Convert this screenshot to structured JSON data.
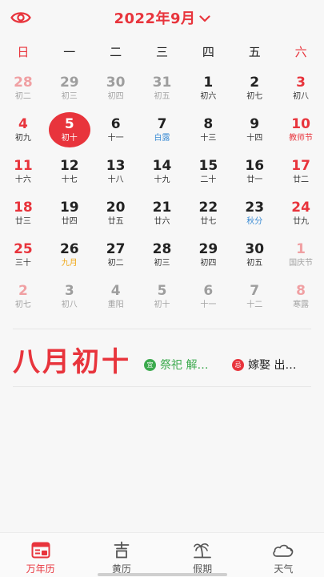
{
  "header": {
    "title": "2022年9月",
    "icons": {
      "left": "eye-icon",
      "title_suffix": "chevron-down-icon"
    }
  },
  "weekdays": [
    "日",
    "一",
    "二",
    "三",
    "四",
    "五",
    "六"
  ],
  "calendar": {
    "rows": [
      [
        {
          "day": "28",
          "sub": "初二",
          "other": true,
          "weekend": true
        },
        {
          "day": "29",
          "sub": "初三",
          "other": true
        },
        {
          "day": "30",
          "sub": "初四",
          "other": true
        },
        {
          "day": "31",
          "sub": "初五",
          "other": true
        },
        {
          "day": "1",
          "sub": "初六"
        },
        {
          "day": "2",
          "sub": "初七"
        },
        {
          "day": "3",
          "sub": "初八",
          "weekend": true
        }
      ],
      [
        {
          "day": "4",
          "sub": "初九",
          "weekend": true
        },
        {
          "day": "5",
          "sub": "初十",
          "today": true
        },
        {
          "day": "6",
          "sub": "十一"
        },
        {
          "day": "7",
          "sub": "白露",
          "sub_style": "term"
        },
        {
          "day": "8",
          "sub": "十三"
        },
        {
          "day": "9",
          "sub": "十四"
        },
        {
          "day": "10",
          "sub": "教师节",
          "weekend": true,
          "sub_style": "festival"
        }
      ],
      [
        {
          "day": "11",
          "sub": "十六",
          "weekend": true
        },
        {
          "day": "12",
          "sub": "十七"
        },
        {
          "day": "13",
          "sub": "十八"
        },
        {
          "day": "14",
          "sub": "十九"
        },
        {
          "day": "15",
          "sub": "二十"
        },
        {
          "day": "16",
          "sub": "廿一"
        },
        {
          "day": "17",
          "sub": "廿二",
          "weekend": true
        }
      ],
      [
        {
          "day": "18",
          "sub": "廿三",
          "weekend": true
        },
        {
          "day": "19",
          "sub": "廿四"
        },
        {
          "day": "20",
          "sub": "廿五"
        },
        {
          "day": "21",
          "sub": "廿六"
        },
        {
          "day": "22",
          "sub": "廿七"
        },
        {
          "day": "23",
          "sub": "秋分",
          "sub_style": "term"
        },
        {
          "day": "24",
          "sub": "廿九",
          "weekend": true
        }
      ],
      [
        {
          "day": "25",
          "sub": "三十",
          "weekend": true
        },
        {
          "day": "26",
          "sub": "九月",
          "sub_style": "lunar-month"
        },
        {
          "day": "27",
          "sub": "初二"
        },
        {
          "day": "28",
          "sub": "初三"
        },
        {
          "day": "29",
          "sub": "初四"
        },
        {
          "day": "30",
          "sub": "初五"
        },
        {
          "day": "1",
          "sub": "国庆节",
          "other": true,
          "weekend": true
        }
      ],
      [
        {
          "day": "2",
          "sub": "初七",
          "other": true,
          "weekend": true
        },
        {
          "day": "3",
          "sub": "初八",
          "other": true
        },
        {
          "day": "4",
          "sub": "重阳",
          "other": true
        },
        {
          "day": "5",
          "sub": "初十",
          "other": true
        },
        {
          "day": "6",
          "sub": "十一",
          "other": true
        },
        {
          "day": "7",
          "sub": "十二",
          "other": true
        },
        {
          "day": "8",
          "sub": "寒露",
          "other": true,
          "weekend": true
        }
      ]
    ]
  },
  "detail": {
    "lunar_date": "八月初十",
    "yi_badge": "宜",
    "yi_text": "祭祀 解…",
    "ji_badge": "忌",
    "ji_text": "嫁娶 出…"
  },
  "tabbar": {
    "tabs": [
      {
        "label": "万年历",
        "icon": "calendar-icon",
        "active": true
      },
      {
        "label": "黄历",
        "icon": "ji-character-icon"
      },
      {
        "label": "假期",
        "icon": "palm-tree-icon"
      },
      {
        "label": "天气",
        "icon": "cloud-icon"
      }
    ]
  },
  "colors": {
    "accent": "#e8343c",
    "term": "#3a8bd4",
    "yi": "#3caa4e",
    "lunar_month": "#f0a818"
  }
}
